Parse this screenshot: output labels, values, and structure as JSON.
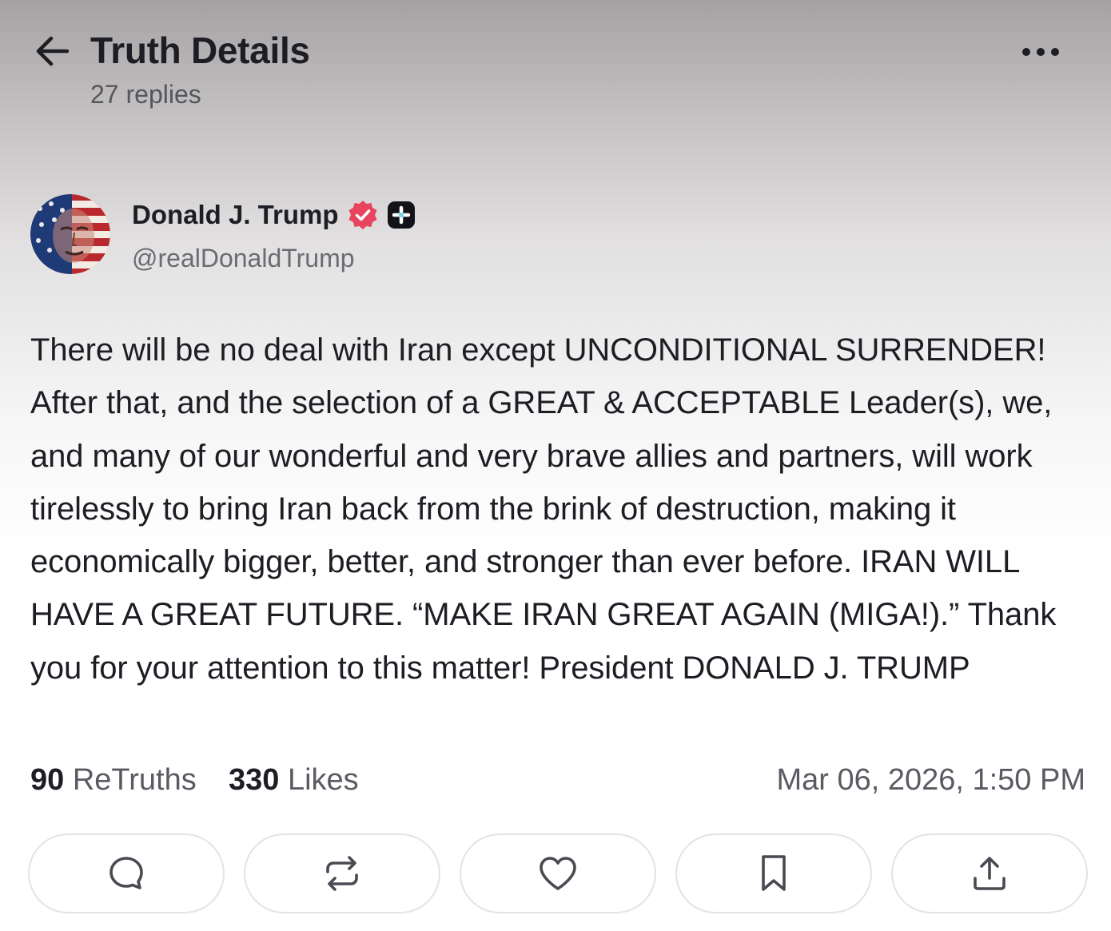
{
  "header": {
    "title": "Truth Details",
    "replies": "27 replies"
  },
  "author": {
    "display_name": "Donald J. Trump",
    "handle": "@realDonaldTrump"
  },
  "post": {
    "text": "There will be no deal with Iran except UNCONDITIONAL SURRENDER! After that, and the selection of a GREAT & ACCEPTABLE Leader(s), we, and many of our wonderful and very brave allies and partners, will work tirelessly to bring Iran back from the brink of destruction, making it economically bigger, better, and stronger than ever before. IRAN WILL HAVE A GREAT FUTURE. “MAKE IRAN GREAT AGAIN (MIGA!).” Thank you for your attention to this matter! President DONALD J. TRUMP"
  },
  "stats": {
    "retruths_count": "90",
    "retruths_label": "ReTruths",
    "likes_count": "330",
    "likes_label": "Likes",
    "timestamp": "Mar 06, 2026, 1:50 PM"
  },
  "icons": {
    "back": "arrow-left-icon",
    "more": "more-horizontal-icon",
    "verified": "verified-badge-icon",
    "plus": "plus-badge-icon",
    "reply": "reply-bubble-icon",
    "retruth": "retruth-arrows-icon",
    "like": "heart-icon",
    "bookmark": "bookmark-icon",
    "share": "share-upload-icon"
  },
  "colors": {
    "verified": "#e8435f",
    "text": "#1d1d24",
    "muted": "#5a5a62",
    "button_border": "#e3e3e6"
  }
}
